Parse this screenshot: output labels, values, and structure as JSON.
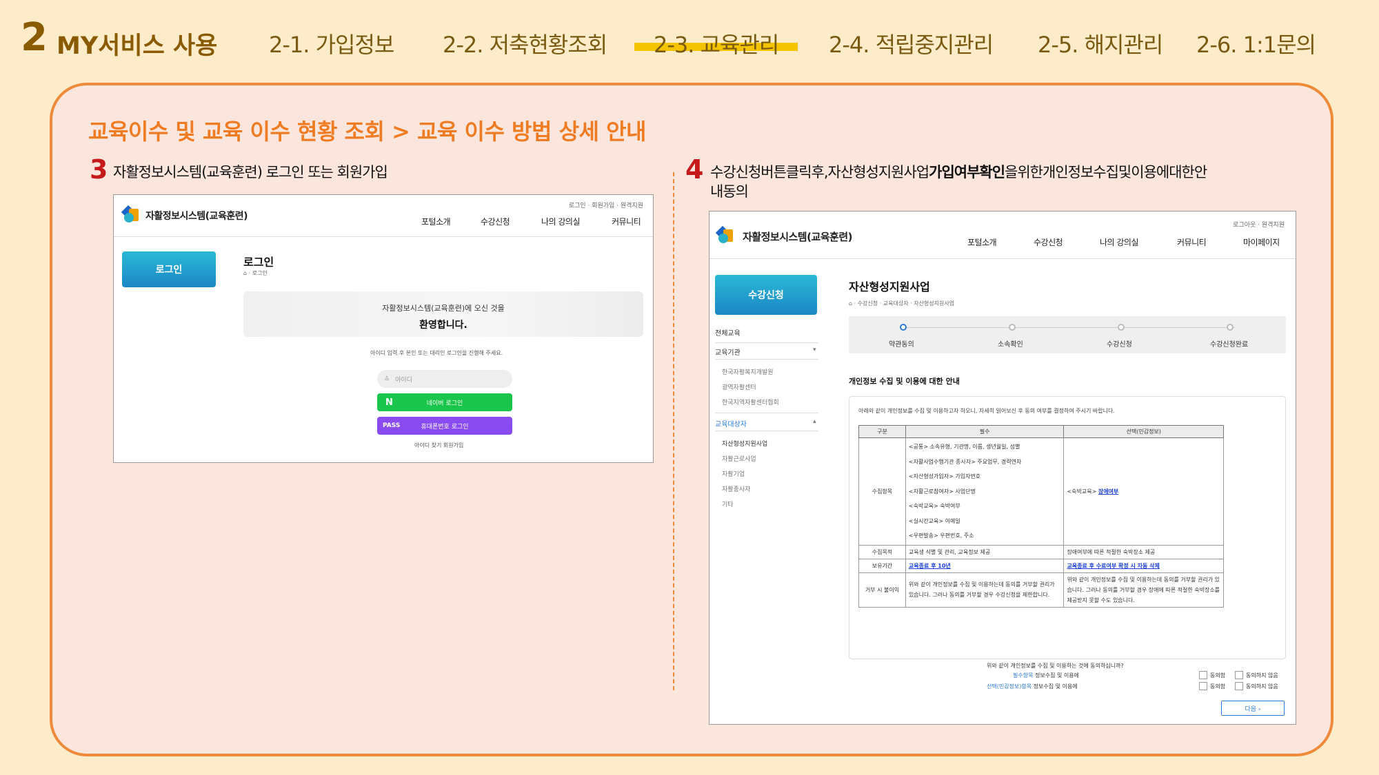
{
  "header": {
    "section_number": "2",
    "section_title": "MY서비스 사용",
    "nav": [
      "2-1. 가입정보",
      "2-2. 저축현황조회",
      "2-3. 교육관리",
      "2-4. 적립중지관리",
      "2-5. 해지관리",
      "2-6. 1:1문의"
    ],
    "active_index": 2
  },
  "panel": {
    "breadcrumb": "교육이수 및 교육 이수 현황 조회 > 교육 이수 방법 상세 안내",
    "step3": {
      "num": "3",
      "text": "자활정보시스템(교육훈련) 로그인 또는 회원가입"
    },
    "step4": {
      "num": "4",
      "text_pre": "수강신청버튼클릭후,자산형성지원사업",
      "text_bold": "가입여부확인",
      "text_post": "을위한개인정보수집및이용에대한안",
      "text_line2": "내동의"
    }
  },
  "shot1": {
    "brand": "자활정보시스템(교육훈련)",
    "util": "로그인 · 회원가입 · 원격지원",
    "gnb": [
      "포털소개",
      "수강신청",
      "나의 강의실",
      "커뮤니티"
    ],
    "side_button": "로그인",
    "page_title": "로그인",
    "crumb": "⌂ · 로그인",
    "welcome1": "자활정보시스템(교육훈련)에 오신 것을",
    "welcome2": "환영합니다.",
    "guide": "아이디 입력 후 본인 또는 대리인 로그인을 진행해 주세요.",
    "id_placeholder": "아이디",
    "naver_icon": "N",
    "naver_label": "네이버 로그인",
    "pass_icon": "PASS",
    "pass_label": "휴대폰번호 로그인",
    "links": "아이디 찾기   회원가입",
    "colors": {
      "naver": "#19c54a",
      "pass": "#8a4cf0",
      "side": "#1b87c6"
    }
  },
  "shot2": {
    "brand": "자활정보시스템(교육훈련)",
    "util": "로그아웃 · 원격지원",
    "gnb": [
      "포털소개",
      "수강신청",
      "나의 강의실",
      "커뮤니티",
      "마이페이지"
    ],
    "side_button": "수강신청",
    "side_menu": [
      {
        "label": "전체교육",
        "type": "main"
      },
      {
        "label": "교육기관",
        "type": "main"
      },
      {
        "label": "한국자활복지개발원",
        "type": "sub"
      },
      {
        "label": "광역자활센터",
        "type": "sub"
      },
      {
        "label": "한국지역자활센터협회",
        "type": "sub"
      },
      {
        "label": "교육대상자",
        "type": "blue"
      },
      {
        "label": "자산형성지원사업",
        "type": "sub-dark"
      },
      {
        "label": "자활근로사업",
        "type": "sub"
      },
      {
        "label": "자활기업",
        "type": "sub"
      },
      {
        "label": "자활종사자",
        "type": "sub"
      },
      {
        "label": "기타",
        "type": "sub"
      }
    ],
    "page_title": "자산형성지원사업",
    "crumb": "⌂ · 수강신청 · 교육대상자 · 자산형성지원사업",
    "steps": [
      "약관동의",
      "소속확인",
      "수강신청",
      "수강신청완료"
    ],
    "section_title": "개인정보 수집 및 이용에 대한 안내",
    "intro": "아래와 같이 개인정보를 수집 및 이용하고자 하오니, 자세히 읽어보신 후 동의 여부를 결정하여 주시기 바랍니다.",
    "table": {
      "headers": [
        "구분",
        "필수",
        "선택(민감정보)"
      ],
      "row_collect_label": "수집항목",
      "collect_required": [
        "<공통> 소속유형, 기관명, 이름, 생년월일, 성별",
        "<자활사업수행기관 종사자> 주요업무, 경력연차",
        "<자산형성가입자> 가입자번호",
        "<자활근로참여자> 사업단명",
        "<숙박교육> 숙박여부",
        "<실시간교육> 이메일",
        "<우편발송> 우편번호, 주소"
      ],
      "collect_optional_pre": "<숙박교육> ",
      "collect_optional_link": "장애여부",
      "purpose_label": "수집목적",
      "purpose_required": "교육생 식별 및 관리, 교육정보 제공",
      "purpose_optional": "장애여부에 따른 적절한 숙박장소 제공",
      "retention_label": "보유기간",
      "retention_required": "교육종료 후 10년",
      "retention_optional": "교육종료 후 수료여부 확정 시 자동 삭제",
      "refuse_label": "거부 시 불이익",
      "refuse_required": "위와 같이 개인정보를 수집 및 이용하는데 동의를 거부할 권리가 있습니다. 그러나 동의를 거부할 경우 수강신청을 제한합니다.",
      "refuse_optional": "위와 같이 개인정보를 수집 및 이용하는데 동의를 거부할 권리가 있습니다. 그러나 동의를 거부할 경우 장애에 따른 적절한 숙박장소를 제공받지 못할 수도 있습니다."
    },
    "agree_question": "위와 같이 개인정보를 수집 및 이용하는 것에 동의하십니까?",
    "agree_req_prefix": "필수항목",
    "agree_req_suffix": " 정보수집 및 이용에",
    "agree_opt_prefix": "선택(민감정보)항목",
    "agree_opt_suffix": " 정보수집 및 이용에",
    "agree_yes": "동의함",
    "agree_no": "동의하지 않음",
    "next_button": "다음  ›"
  }
}
